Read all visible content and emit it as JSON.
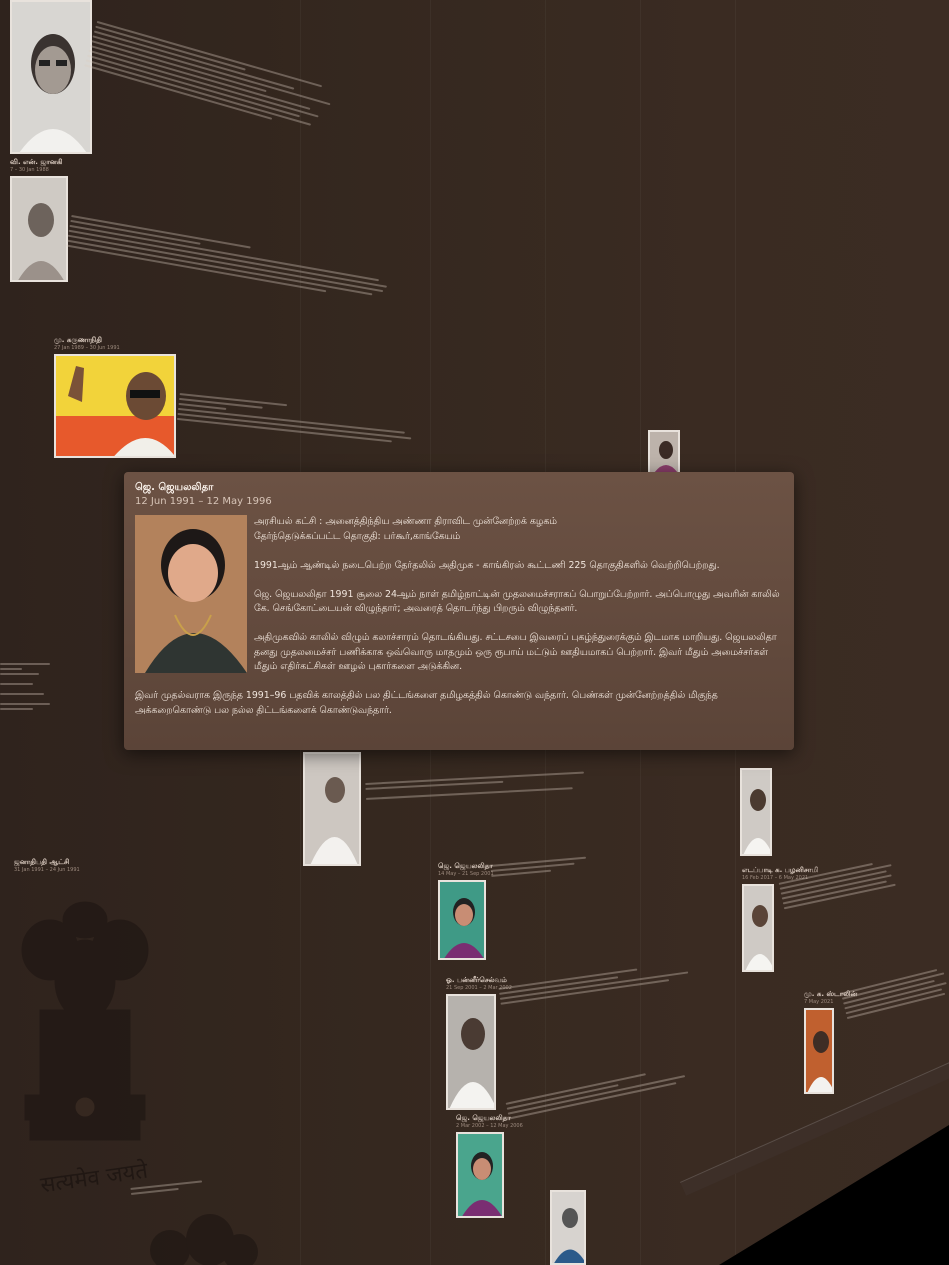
{
  "popup": {
    "name": "ஜெ. ஜெயலலிதா",
    "dates": "12 Jun 1991 – 12 May 1996",
    "party": "அரசியல் கட்சி : அனைத்திந்திய அண்ணா திராவிட முன்னேற்றக் கழகம்",
    "constituency": "தேர்ந்தெடுக்கப்பட்ட தொகுதி: பர்கூர்,காங்கேயம்",
    "para1": "1991ஆம் ஆண்டில் நடைபெற்ற தேர்தலில் அதிமுக - காங்கிரஸ் கூட்டணி 225 தொகுதிகளில் வெற்றிபெற்றது.",
    "para2": "ஜெ. ஜெயலலிதா 1991 சூலை 24ஆம் நாள் தமிழ்நாட்டின் முதலமைச்சராகப் பொறுப்பேற்றார். அப்பொழுது அவரின் காலில் கே. செங்கோட்டையன் விழுந்தார்; அவரைத் தொடர்ந்து பிறரும் விழுந்தனர்.",
    "para3": "அதிமுகவில் காலில் விழும் கலாச்சாரம் தொடங்கியது. சட்டசபை இவரைப் புகழ்ந்துரைக்கும் இடமாக மாறியது. ஜெயலலிதா தனது முதலமைச்சர் பணிக்காக ஒவ்வொரு மாதமும் ஒரு ரூபாய் மட்டும் ஊதியமாகப் பெற்றார். இவர் மீதும் அமைச்சர்கள் மீதும் எதிர்கட்சிகள் ஊழல் புகார்களை அடுக்கின.",
    "para4": "இவர் முதல்வராக இருந்த 1991–96 பதவிக் காலத்தில் பல திட்டங்களை தமிழகத்தில் கொண்டு வந்தார். பெண்கள் முன்னேற்றத்தில் மிகுந்த அக்கறைகொண்டு பல நல்ல திட்டங்களைக் கொண்டுவந்தார்."
  },
  "background_entries": [
    {
      "name": "வி. என். ஜானகி",
      "dates": "7 – 30 Jan 1988"
    },
    {
      "name": "மு. கருணாநிதி",
      "dates": "27 Jan 1989 – 30 Jun 1991"
    },
    {
      "name": "ஜெ. ஜெயலலிதா",
      "dates": "14 May – 21 Sep 2001"
    },
    {
      "name": "ஓ. பன்னீர்செல்வம்",
      "dates": "21 Sep 2001 – 2 Mar 2002"
    },
    {
      "name": "ஜெ. ஜெயலலிதா",
      "dates": "2 Mar 2002 – 12 May 2006"
    },
    {
      "name": "மு. க. ஸ்டாலின்",
      "dates": "7 May 2021"
    },
    {
      "name": "எடப்பாடி க. பழனிசாமி",
      "dates": "16 Feb 2017 – 6 May 2021"
    },
    {
      "name": "ஜனாதிபதி ஆட்சி",
      "dates": "31 Jan 1991 – 24 Jun 1991"
    }
  ],
  "emblem_motto": "सत्यमेव जयते",
  "colors": {
    "background": "#2e221c",
    "popup_top": "#6c5244",
    "popup_bottom": "#5b4438",
    "text": "#f1e6dd"
  }
}
